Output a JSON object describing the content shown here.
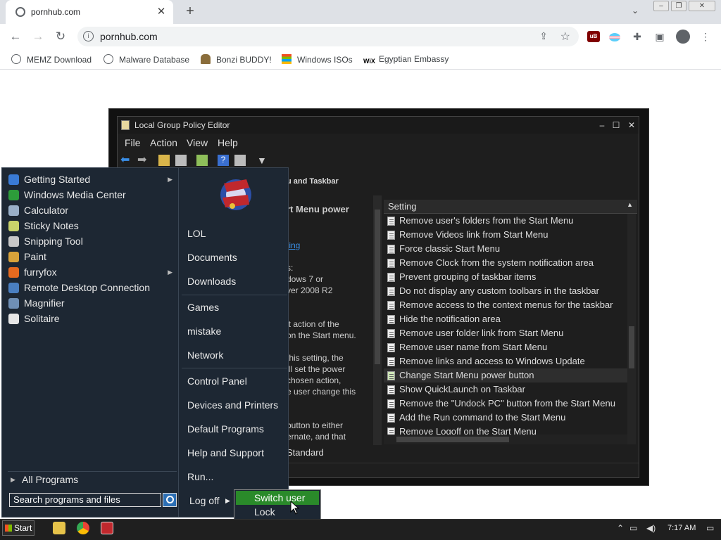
{
  "browser": {
    "tab_title": "pornhub.com",
    "tab_close": "✕",
    "new_tab": "+",
    "url": "pornhub.com",
    "bookmarks": [
      "MEMZ Download",
      "Malware Database",
      "Bonzi BUDDY!",
      "Windows ISOs",
      "Egyptian Embassy"
    ]
  },
  "gpe": {
    "title": "Local Group Policy Editor",
    "menu": [
      "File",
      "Action",
      "View",
      "Help"
    ],
    "breadcrumb": "u and Taskbar",
    "policy_title": "rt Menu power",
    "left_fragments": [
      "ting",
      "s:",
      "dows 7 or",
      "ver 2008 R2",
      "lt action of the",
      "on the Start menu.",
      "this setting, the",
      "ill set the power",
      "chosen action,",
      "e user change this",
      "button to either",
      "ernate, and that"
    ],
    "column_header": "Setting",
    "settings": [
      "Remove user's folders from the Start Menu",
      "Remove Videos link from Start Menu",
      "Force classic Start Menu",
      "Remove Clock from the system notification area",
      "Prevent grouping of taskbar items",
      "Do not display any custom toolbars in the taskbar",
      "Remove access to the context menus for the taskbar",
      "Hide the notification area",
      "Remove user folder link from Start Menu",
      "Remove user name from Start Menu",
      "Remove links and access to Windows Update",
      "Change Start Menu power button",
      "Show QuickLaunch on Taskbar",
      "Remove the \"Undock PC\" button from the Start Menu",
      "Add the Run command to the Start Menu",
      "Remove Logoff on the Start Menu"
    ],
    "selected_index": 11,
    "tab_label": "Standard"
  },
  "startmenu": {
    "programs": [
      {
        "label": "Getting Started",
        "icon": "getting-started-icon",
        "color": "#3a7bd5",
        "submenu": true
      },
      {
        "label": "Windows Media Center",
        "icon": "media-center-icon",
        "color": "#2d9c3a",
        "submenu": false
      },
      {
        "label": "Calculator",
        "icon": "calculator-icon",
        "color": "#9ab0c8",
        "submenu": false
      },
      {
        "label": "Sticky Notes",
        "icon": "sticky-notes-icon",
        "color": "#c9d36a",
        "submenu": false
      },
      {
        "label": "Snipping Tool",
        "icon": "snipping-tool-icon",
        "color": "#c7c7c7",
        "submenu": false
      },
      {
        "label": "Paint",
        "icon": "paint-icon",
        "color": "#d9a33a",
        "submenu": false
      },
      {
        "label": "furryfox",
        "icon": "furryfox-icon",
        "color": "#e66a1f",
        "submenu": true
      },
      {
        "label": "Remote Desktop Connection",
        "icon": "remote-desktop-icon",
        "color": "#4a7fc1",
        "submenu": false
      },
      {
        "label": "Magnifier",
        "icon": "magnifier-icon",
        "color": "#6f8fb5",
        "submenu": false
      },
      {
        "label": "Solitaire",
        "icon": "solitaire-icon",
        "color": "#e6e6e6",
        "submenu": false
      }
    ],
    "all_programs": "All Programs",
    "search_placeholder": "Search programs and files",
    "places": [
      "LOL",
      "Documents",
      "Downloads",
      "Games",
      "mistake",
      "Network",
      "Control Panel",
      "Devices and Printers",
      "Default Programs",
      "Help and Support",
      "Run..."
    ],
    "logoff": "Log off",
    "submenu": [
      "Switch user",
      "Lock"
    ]
  },
  "taskbar": {
    "start": "Start",
    "clock": "7:17 AM"
  }
}
